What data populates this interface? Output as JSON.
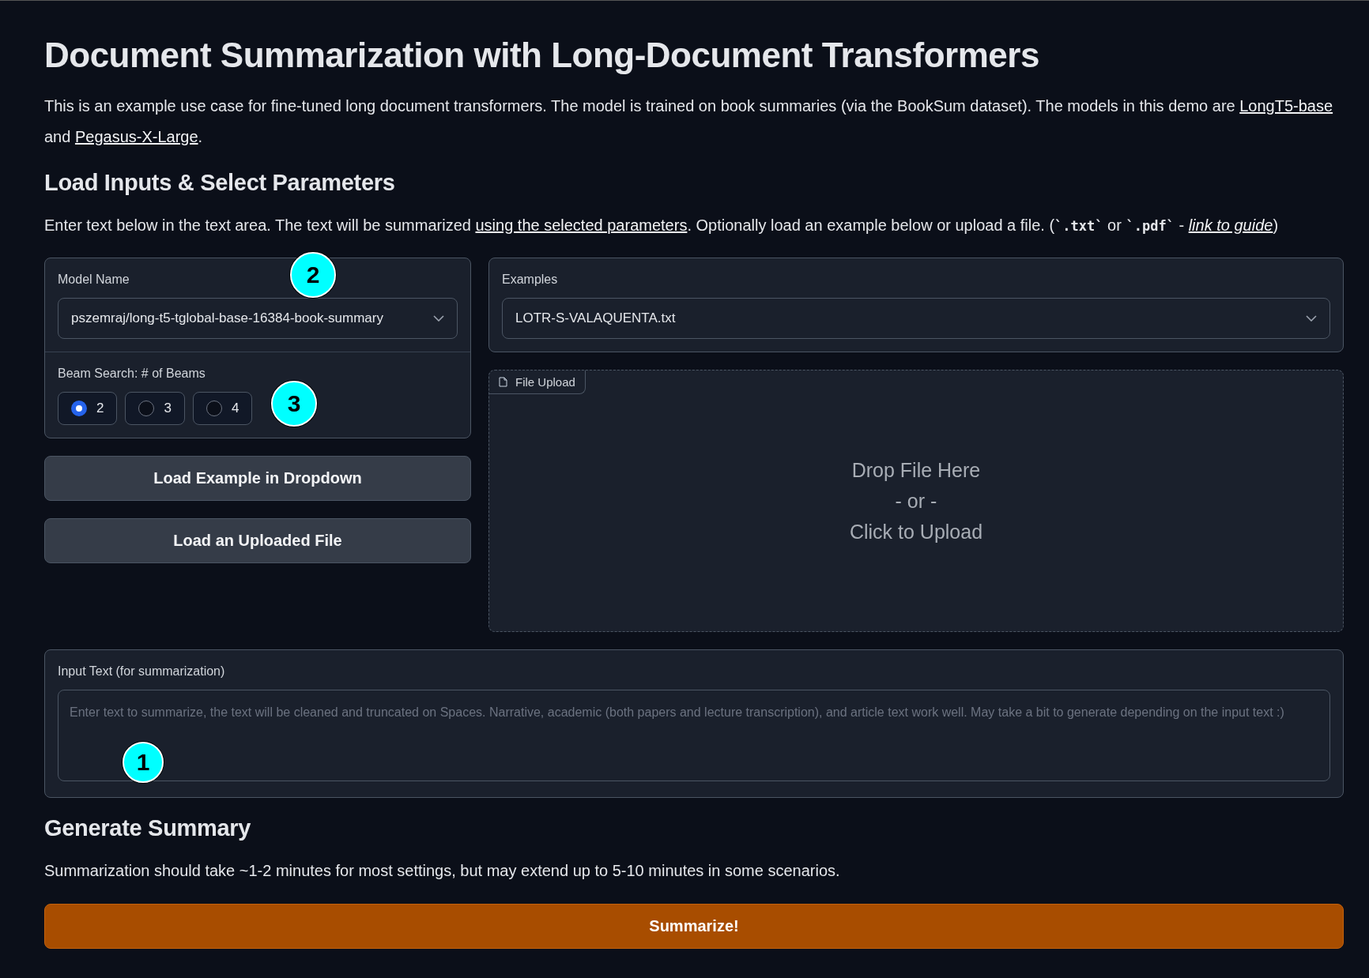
{
  "title": "Document Summarization with Long-Document Transformers",
  "intro": [
    {
      "kind": "text",
      "text": "This is an example use case for fine-tuned long document transformers. The model is trained on book summaries (via the BookSum dataset). The models in this demo are "
    },
    {
      "kind": "link",
      "text": "LongT5-base"
    },
    {
      "kind": "text",
      "text": " and "
    },
    {
      "kind": "link",
      "text": "Pegasus-X-Large"
    },
    {
      "kind": "text",
      "text": "."
    }
  ],
  "section_heading": "Load Inputs & Select Parameters",
  "instructions": [
    {
      "kind": "text",
      "text": "Enter text below in the text area. The text will be summarized "
    },
    {
      "kind": "link",
      "text": "using the selected parameters"
    },
    {
      "kind": "text",
      "text": ". Optionally load an example below or upload a file. ("
    },
    {
      "kind": "code",
      "text": "`.txt`"
    },
    {
      "kind": "text",
      "text": " or "
    },
    {
      "kind": "code",
      "text": "`.pdf`"
    },
    {
      "kind": "text",
      "text": " - "
    },
    {
      "kind": "italic_link",
      "text": "link to guide"
    },
    {
      "kind": "text",
      "text": ")"
    }
  ],
  "model_name": {
    "label": "Model Name",
    "value": "pszemraj/long-t5-tglobal-base-16384-book-summary",
    "marker": "2"
  },
  "beams": {
    "label": "Beam Search: # of Beams",
    "marker": "3",
    "options": [
      {
        "label": "2",
        "selected": true
      },
      {
        "label": "3",
        "selected": false
      },
      {
        "label": "4",
        "selected": false
      }
    ]
  },
  "buttons": [
    "Load Example in Dropdown",
    "Load an Uploaded File"
  ],
  "examples": {
    "label": "Examples",
    "value": "LOTR-S-VALAQUENTA.txt"
  },
  "file_upload": {
    "label": "File Upload",
    "lines": [
      "Drop File Here",
      "- or -",
      "Click to Upload"
    ]
  },
  "input_text": {
    "label": "Input Text (for summarization)",
    "placeholder": "Enter text to summarize, the text will be cleaned and truncated on Spaces. Narrative, academic (both papers and lecture transcription), and article text work well. May take a bit to generate depending on the input text :)",
    "marker": "1"
  },
  "generate_heading": "Generate Summary",
  "generate_note": "Summarization should take ~1-2 minutes for most settings, but may extend up to 5-10 minutes in some scenarios.",
  "summarize_button": "Summarize!"
}
